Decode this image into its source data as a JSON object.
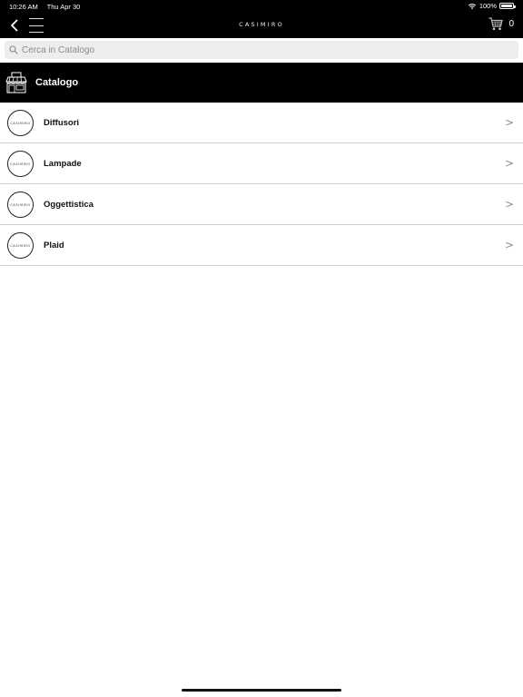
{
  "status_bar": {
    "time": "10:26 AM",
    "date": "Thu Apr 30",
    "battery": "100%",
    "battery_level": 1.0,
    "wifi_icon": "wifi-icon"
  },
  "nav": {
    "logo": "CASIMIRO",
    "back_icon": "chevron-left-icon",
    "menu_icon": "hamburger-menu-icon",
    "cart_icon": "cart-icon",
    "cart_count": "0"
  },
  "search": {
    "placeholder": "Cerca in Catalogo",
    "value": "",
    "icon": "search-icon"
  },
  "section": {
    "title": "Catalogo",
    "icon": "storefront-icon"
  },
  "categories": [
    {
      "label": "Diffusori",
      "thumb_text": "CASIMIRO"
    },
    {
      "label": "Lampade",
      "thumb_text": "CASIMIRO"
    },
    {
      "label": "Oggettistica",
      "thumb_text": "CASIMIRO"
    },
    {
      "label": "Plaid",
      "thumb_text": "CASIMIRO"
    }
  ],
  "chevron": ">",
  "colors": {
    "bar_background": "#000000",
    "search_background": "#ededed",
    "divider": "#cfcfcf",
    "chevron": "#8d8d8d"
  }
}
